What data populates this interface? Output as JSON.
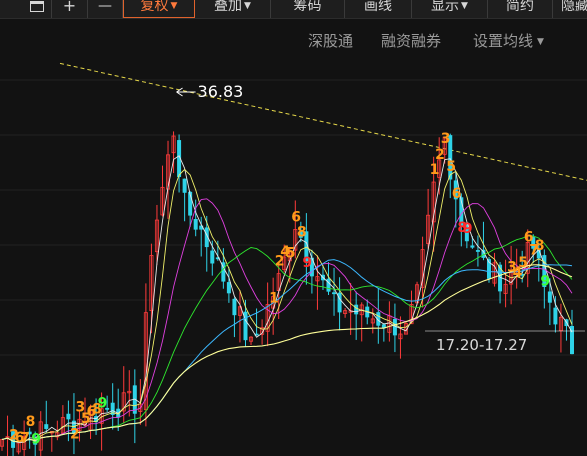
{
  "toolbar": {
    "items": [
      {
        "label": "",
        "icon": "calendar-icon"
      },
      {
        "label": "+",
        "icon": "zoom-in-icon"
      },
      {
        "label": "—",
        "icon": "zoom-out-icon"
      },
      {
        "label": "复权",
        "caret": true,
        "active": true
      },
      {
        "label": "叠加",
        "caret": true
      },
      {
        "label": "筹码"
      },
      {
        "label": "画线"
      },
      {
        "label": "显示",
        "caret": true
      },
      {
        "label": "简约"
      },
      {
        "label": "隐藏"
      }
    ]
  },
  "sub_links": {
    "shengutong": "深股通",
    "rongzi": "融资融券",
    "ma_settings": "设置均线"
  },
  "colors": {
    "background": "#121212",
    "up_candle": "#ff3b3b",
    "down_candle": "#2fd3e8",
    "trendline": "#e6d84a",
    "signal_orange": "#ff9a1a",
    "signal_red": "#ff2a2a",
    "signal_green": "#3cff3c",
    "ma_white": "#e8e8e8",
    "ma_yellow": "#f0f06a",
    "ma_magenta": "#e040e0",
    "ma_green": "#2ee82e",
    "ma_cyan": "#3cb8ff",
    "ma_lightyellow": "#ffff99"
  },
  "chart_data": {
    "type": "candlestick",
    "price_axis_estimate": [
      14,
      38
    ],
    "max_label": "36.83",
    "range_label": "17.20-17.27",
    "trendline": {
      "from": 37.5,
      "to": 30.5
    },
    "candle_count": 104,
    "anchors": [
      [
        0,
        15.0
      ],
      [
        8,
        15.5
      ],
      [
        14,
        16.2
      ],
      [
        20,
        17.0
      ],
      [
        25,
        17.2
      ],
      [
        27,
        26.5
      ],
      [
        31,
        33.5
      ],
      [
        33,
        29.0
      ],
      [
        36,
        27.5
      ],
      [
        41,
        24.0
      ],
      [
        45,
        20.5
      ],
      [
        50,
        24.5
      ],
      [
        53,
        28.0
      ],
      [
        56,
        25.5
      ],
      [
        60,
        23.0
      ],
      [
        65,
        22.5
      ],
      [
        70,
        22.0
      ],
      [
        73,
        21.5
      ],
      [
        75,
        23.5
      ],
      [
        78,
        30.0
      ],
      [
        80,
        33.0
      ],
      [
        83,
        28.0
      ],
      [
        86,
        26.0
      ],
      [
        88,
        25.0
      ],
      [
        91,
        24.5
      ],
      [
        94,
        25.5
      ],
      [
        96,
        26.5
      ],
      [
        98,
        24.0
      ],
      [
        100,
        22.5
      ],
      [
        103,
        20.5
      ]
    ],
    "signals": [
      {
        "i": 2,
        "text": "2",
        "color": "orange"
      },
      {
        "i": 3,
        "text": "6",
        "color": "orange"
      },
      {
        "i": 4,
        "text": "7",
        "color": "orange"
      },
      {
        "i": 5,
        "text": "8",
        "color": "orange"
      },
      {
        "i": 6,
        "text": "9",
        "color": "green"
      },
      {
        "i": 13,
        "text": "2",
        "color": "orange"
      },
      {
        "i": 14,
        "text": "3",
        "color": "orange"
      },
      {
        "i": 15,
        "text": "5",
        "color": "orange"
      },
      {
        "i": 16,
        "text": "6",
        "color": "orange"
      },
      {
        "i": 17,
        "text": "8",
        "color": "orange"
      },
      {
        "i": 18,
        "text": "9",
        "color": "green"
      },
      {
        "i": 49,
        "text": "1",
        "color": "orange"
      },
      {
        "i": 50,
        "text": "2",
        "color": "orange"
      },
      {
        "i": 51,
        "text": "4",
        "color": "orange"
      },
      {
        "i": 52,
        "text": "5",
        "color": "orange"
      },
      {
        "i": 53,
        "text": "6",
        "color": "orange"
      },
      {
        "i": 54,
        "text": "8",
        "color": "orange"
      },
      {
        "i": 55,
        "text": "9",
        "color": "red"
      },
      {
        "i": 78,
        "text": "1",
        "color": "orange"
      },
      {
        "i": 79,
        "text": "2",
        "color": "orange"
      },
      {
        "i": 80,
        "text": "3",
        "color": "orange"
      },
      {
        "i": 81,
        "text": "5",
        "color": "orange"
      },
      {
        "i": 82,
        "text": "6",
        "color": "orange"
      },
      {
        "i": 83,
        "text": "8",
        "color": "red"
      },
      {
        "i": 84,
        "text": "9",
        "color": "red"
      },
      {
        "i": 92,
        "text": "3",
        "color": "orange"
      },
      {
        "i": 93,
        "text": "4",
        "color": "orange"
      },
      {
        "i": 94,
        "text": "5",
        "color": "orange"
      },
      {
        "i": 95,
        "text": "6",
        "color": "orange"
      },
      {
        "i": 96,
        "text": "7",
        "color": "orange"
      },
      {
        "i": 97,
        "text": "8",
        "color": "orange"
      },
      {
        "i": 98,
        "text": "9",
        "color": "green"
      }
    ]
  }
}
